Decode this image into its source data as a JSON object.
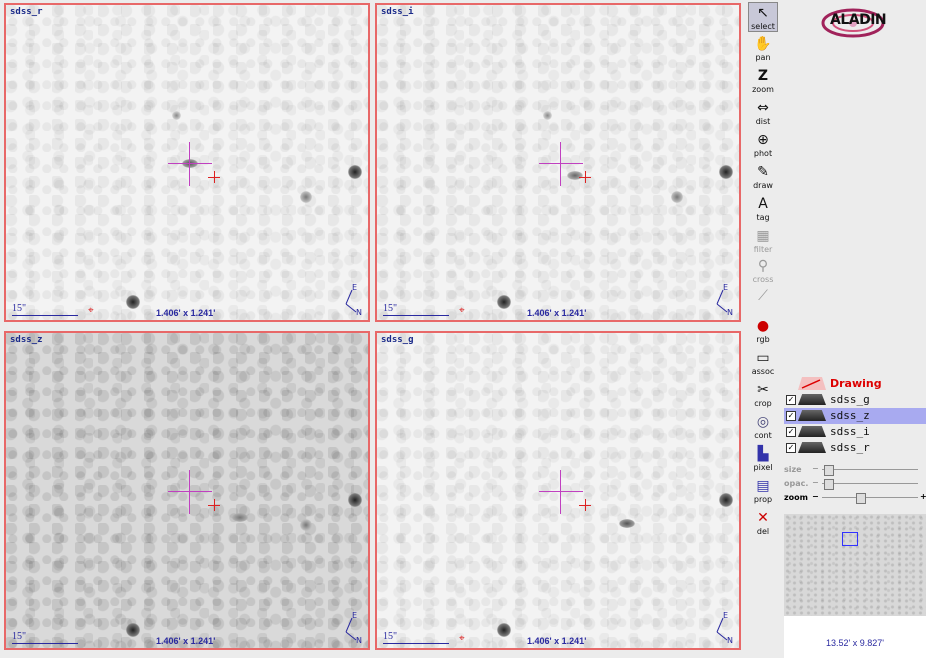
{
  "panels": [
    {
      "label": "sdss_r",
      "scale": "15\"",
      "dims": "1.406' x 1.241'"
    },
    {
      "label": "sdss_i",
      "scale": "15\"",
      "dims": "1.406' x 1.241'"
    },
    {
      "label": "sdss_z",
      "scale": "15\"",
      "dims": "1.406' x 1.241'"
    },
    {
      "label": "sdss_g",
      "scale": "15\"",
      "dims": "1.406' x 1.241'"
    }
  ],
  "compass": {
    "east": "E",
    "north": "N"
  },
  "toolbar": {
    "items": [
      {
        "label": "select",
        "icon": "arrow-cursor-icon"
      },
      {
        "label": "pan",
        "icon": "hand-icon"
      },
      {
        "label": "zoom",
        "icon": "z-icon"
      },
      {
        "label": "dist",
        "icon": "ruler-icon"
      },
      {
        "label": "phot",
        "icon": "target-icon"
      },
      {
        "label": "draw",
        "icon": "pencil-icon"
      },
      {
        "label": "tag",
        "icon": "tag-icon"
      },
      {
        "label": "filter",
        "icon": "filter-icon"
      },
      {
        "label": "cross",
        "icon": "cross-icon"
      },
      {
        "label": "",
        "icon": "graph-icon"
      },
      {
        "label": "rgb",
        "icon": "rgb-icon"
      },
      {
        "label": "assoc",
        "icon": "film-icon"
      },
      {
        "label": "crop",
        "icon": "scissors-icon"
      },
      {
        "label": "cont",
        "icon": "contour-icon"
      },
      {
        "label": "pixel",
        "icon": "chart-icon"
      },
      {
        "label": "prop",
        "icon": "properties-icon"
      },
      {
        "label": "del",
        "icon": "delete-icon"
      }
    ]
  },
  "logo": {
    "text": "ALADIN"
  },
  "layers": {
    "drawing": "Drawing",
    "planes": [
      {
        "name": "sdss_g",
        "checked": true,
        "highlight": false
      },
      {
        "name": "sdss_z",
        "checked": true,
        "highlight": true
      },
      {
        "name": "sdss_i",
        "checked": true,
        "highlight": false
      },
      {
        "name": "sdss_r",
        "checked": true,
        "highlight": false
      }
    ]
  },
  "sliders": {
    "size": {
      "label": "size",
      "value": 0.0
    },
    "opac": {
      "label": "opac.",
      "value": 0.0
    },
    "zoom": {
      "label": "zoom",
      "value": 0.5
    }
  },
  "overview": {
    "dims": "13.52' x 9.827'"
  },
  "colors": {
    "panel_border": "#e86868",
    "crosshair": "#c040c0",
    "selected_plane": "#a8aaf0"
  }
}
